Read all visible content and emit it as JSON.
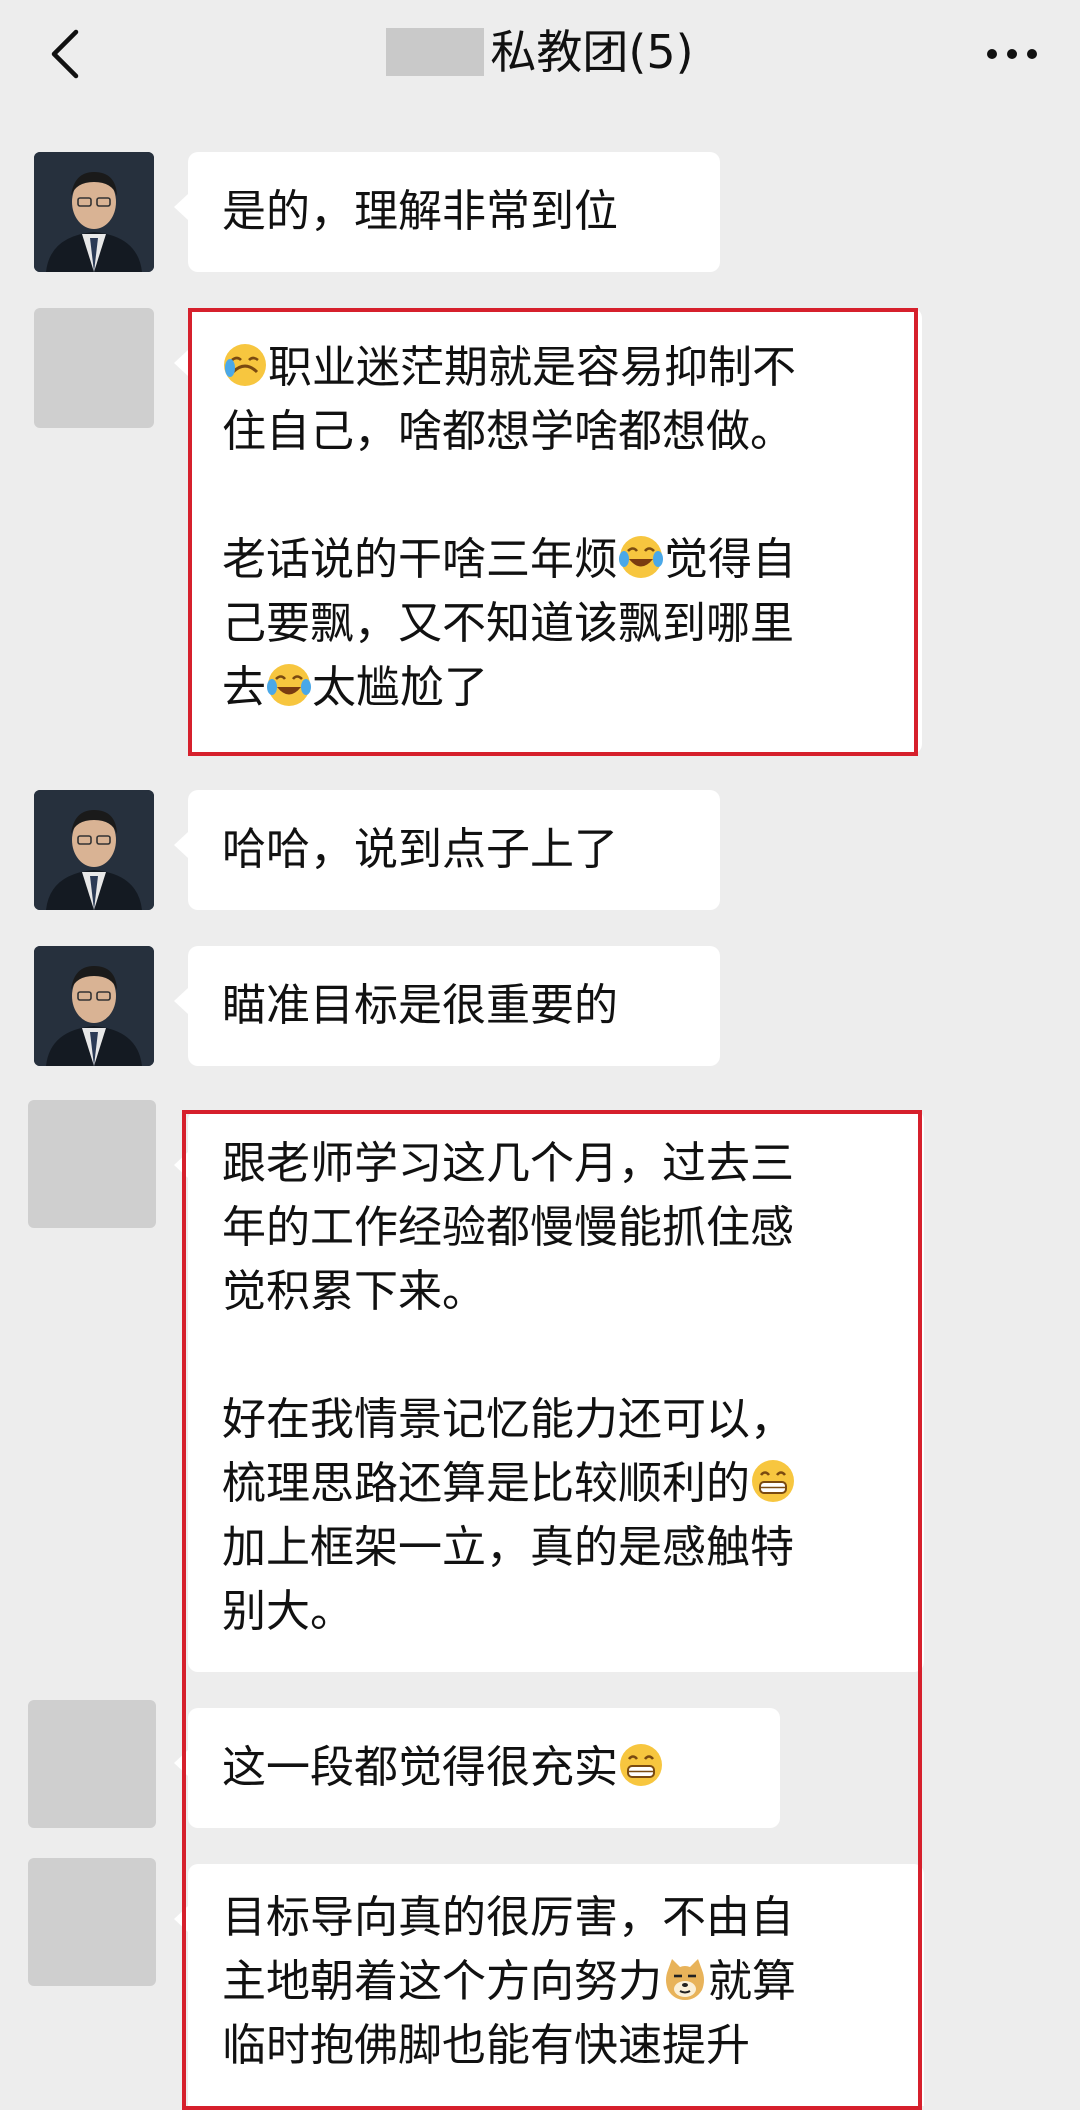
{
  "header": {
    "title": "私教团(5)"
  },
  "messages": [
    {
      "sender": "teacher",
      "lines": [
        "是的，理解非常到位"
      ]
    },
    {
      "sender": "member",
      "line1_pre": "",
      "line1_emoji": "crying-face-emoji",
      "line1_post": "职业迷茫期就是容易抑制不",
      "line2": "住自己，啥都想学啥都想做。",
      "line3_pre": "老话说的干啥三年烦",
      "line3_emoji": "tears-of-joy-emoji",
      "line3_post": "觉得自",
      "line4": "己要飘，又不知道该飘到哪里",
      "line5_pre": "去",
      "line5_emoji": "tears-of-joy-emoji",
      "line5_post": "太尴尬了"
    },
    {
      "sender": "teacher",
      "lines": [
        "哈哈，说到点子上了"
      ]
    },
    {
      "sender": "teacher",
      "lines": [
        "瞄准目标是很重要的"
      ]
    },
    {
      "sender": "member",
      "line1": "跟老师学习这几个月，过去三",
      "line2": "年的工作经验都慢慢能抓住感",
      "line3": "觉积累下来。",
      "line4": "好在我情景记忆能力还可以，",
      "line5_pre": "梳理思路还算是比较顺利的",
      "line5_emoji": "grinning-face-emoji",
      "line6": "加上框架一立，真的是感触特",
      "line7": "别大。"
    },
    {
      "sender": "member",
      "line1_pre": "这一段都觉得很充实",
      "line1_emoji": "grinning-face-emoji"
    },
    {
      "sender": "member",
      "line1": "目标导向真的很厉害，不由自",
      "line2_pre": "主地朝着这个方向努力",
      "line2_emoji": "doge-emoji",
      "line2_post": "就算",
      "line3": "临时抱佛脚也能有快速提升"
    }
  ],
  "colors": {
    "background": "#ededed",
    "bubble": "#ffffff",
    "highlight": "#d6202c"
  }
}
